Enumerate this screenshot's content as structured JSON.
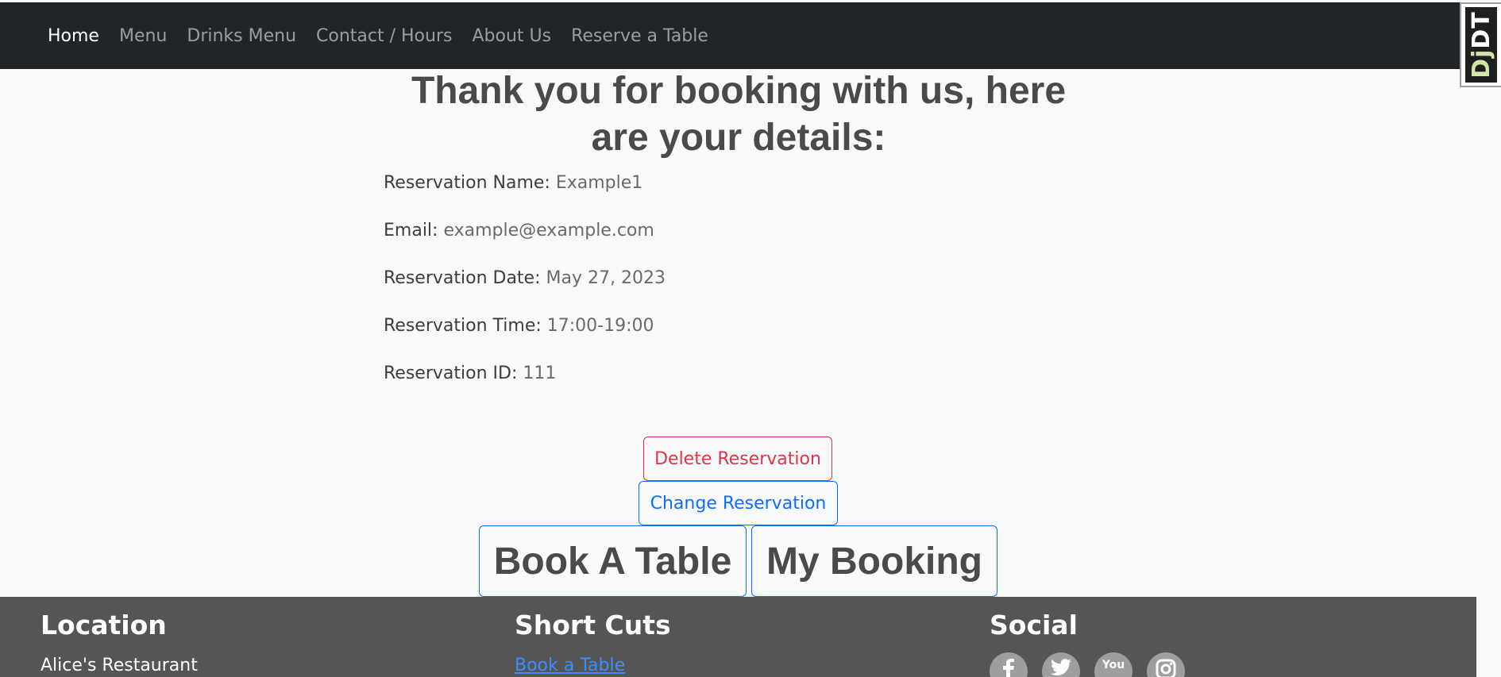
{
  "nav": {
    "items": [
      {
        "label": "Home",
        "active": true
      },
      {
        "label": "Menu"
      },
      {
        "label": "Drinks Menu"
      },
      {
        "label": "Contact / Hours"
      },
      {
        "label": "About Us"
      },
      {
        "label": "Reserve a Table"
      }
    ]
  },
  "debug_toolbar": {
    "prefix": "Dj",
    "suffix": "DT"
  },
  "main": {
    "heading_line1": "Thank you for booking with us, here",
    "heading_line2": "are your details:",
    "details": [
      {
        "label": "Reservation Name:",
        "value": "Example1"
      },
      {
        "label": "Email:",
        "value": "example@example.com"
      },
      {
        "label": "Reservation Date:",
        "value": "May 27, 2023"
      },
      {
        "label": "Reservation Time:",
        "value": "17:00-19:00"
      },
      {
        "label": "Reservation ID:",
        "value": "111"
      }
    ],
    "delete_label": "Delete Reservation",
    "change_label": "Change Reservation",
    "book_label": "Book A Table",
    "my_booking_label": "My Booking"
  },
  "footer": {
    "location": {
      "title": "Location",
      "text": "Alice's Restaurant"
    },
    "shortcuts": {
      "title": "Short Cuts",
      "link": "Book a Table"
    },
    "social": {
      "title": "Social",
      "icons": [
        "facebook-icon",
        "twitter-icon",
        "youtube-icon",
        "instagram-icon"
      ],
      "youtube_text": "You"
    }
  },
  "colors": {
    "navbar_bg": "#212529",
    "footer_bg": "#555555",
    "danger": "#dc3545",
    "primary": "#0d6efd",
    "page_bg": "#f8f9fa"
  }
}
